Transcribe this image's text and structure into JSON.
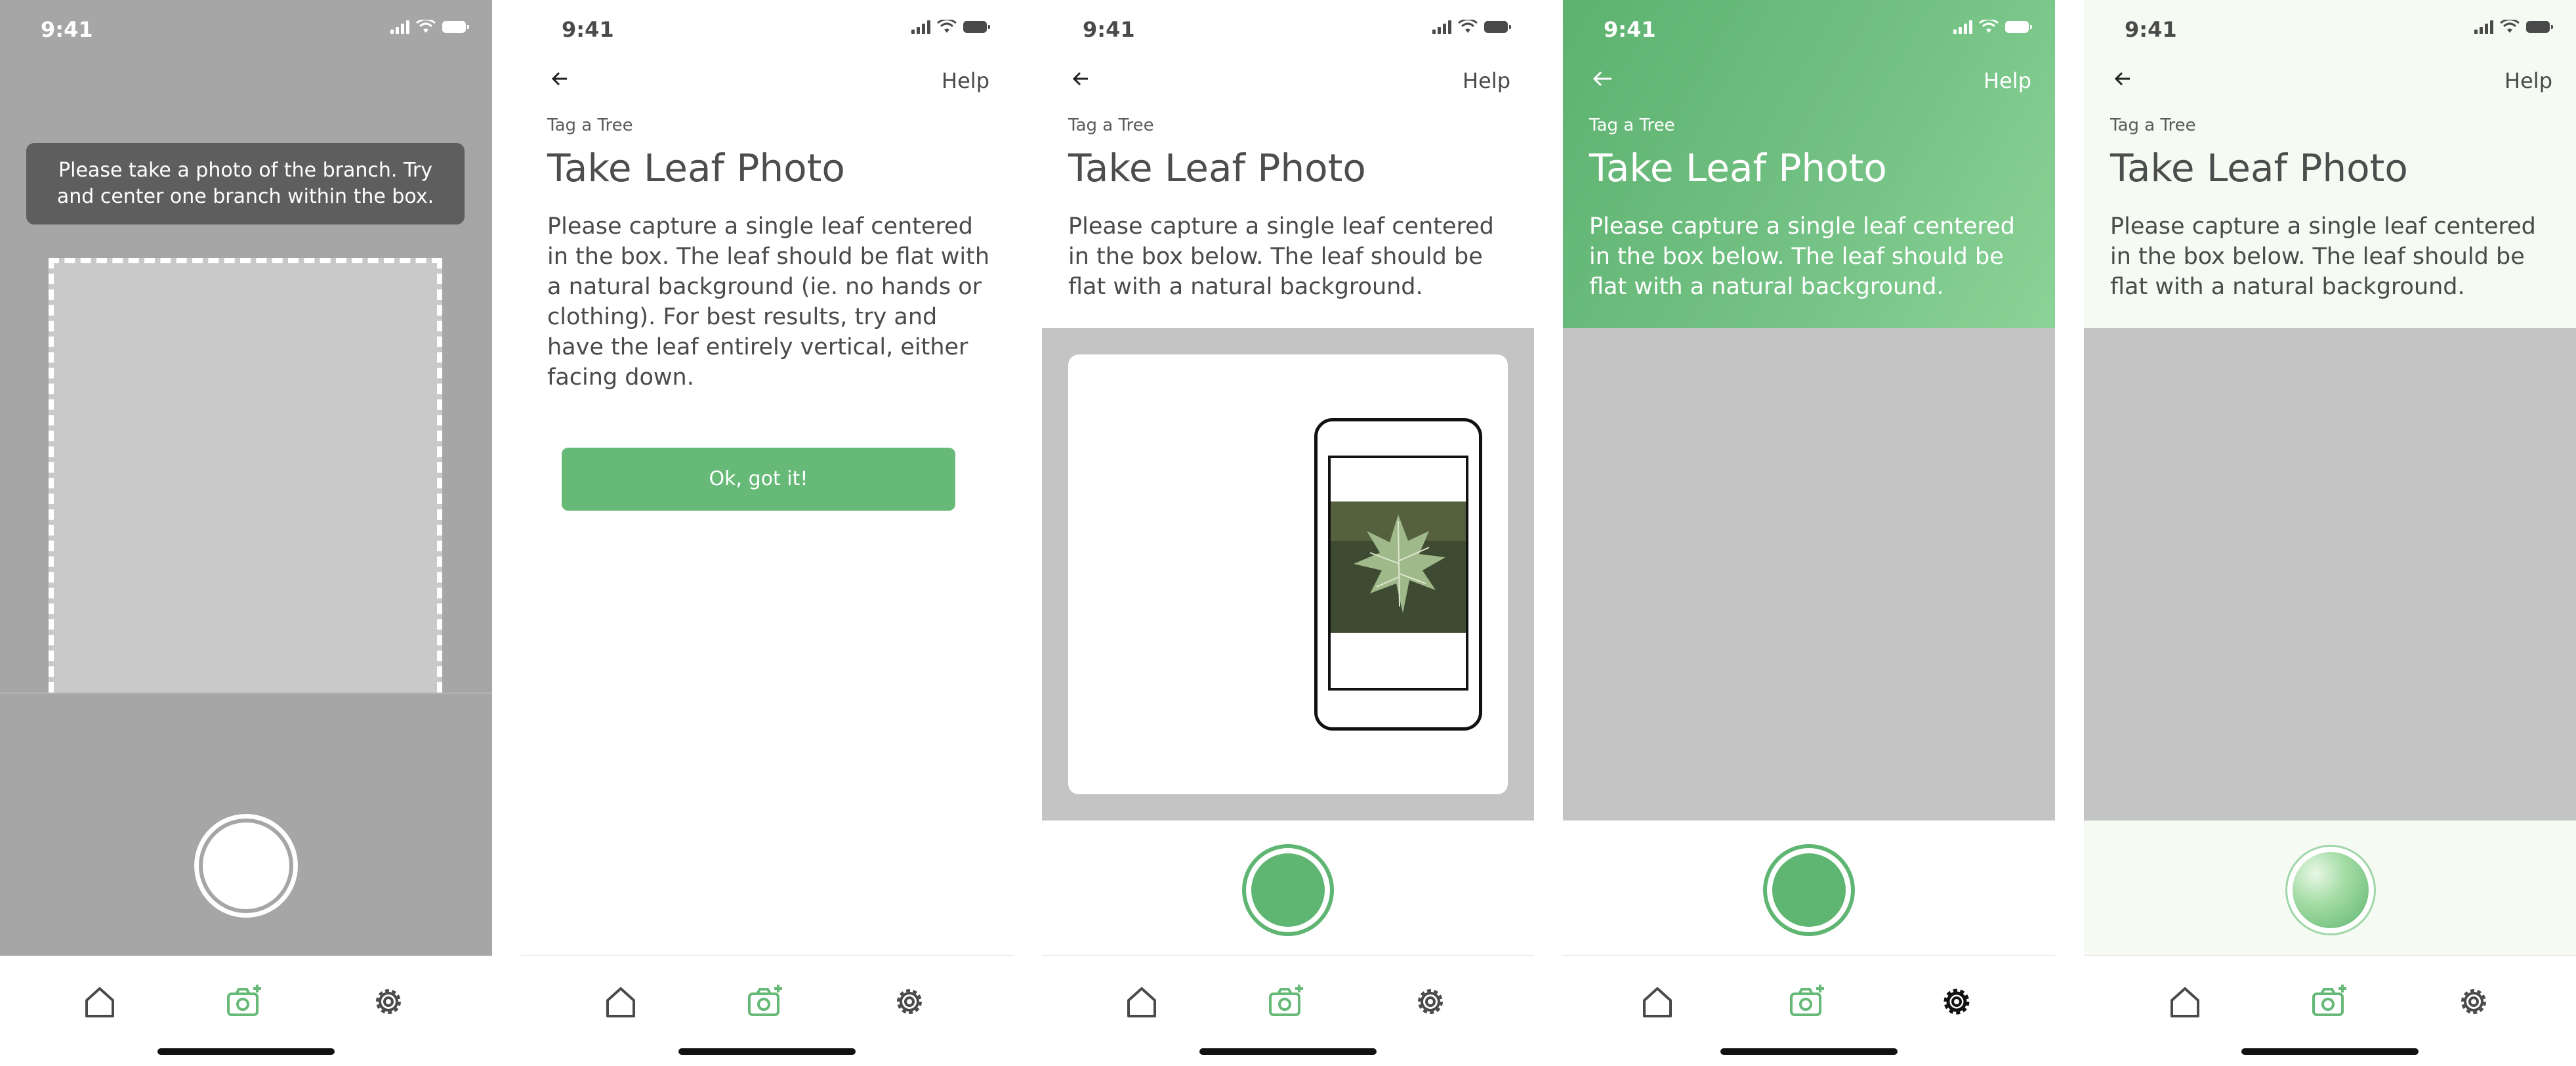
{
  "status_time": "9:41",
  "nav": {
    "help_label": "Help",
    "back_icon": "arrow-left-icon"
  },
  "screen_common": {
    "kicker": "Tag a Tree",
    "title": "Take Leaf Photo"
  },
  "screen1": {
    "tooltip": "Please take a photo of the branch. Try and center one branch within the box."
  },
  "screen2": {
    "description": "Please capture a single leaf centered in the box. The leaf should be flat with a natural background (ie. no hands or clothing). For best results, try and have the leaf entirely vertical, either facing down.",
    "button_label": "Ok, got it!"
  },
  "screen3": {
    "description": "Please capture a single leaf centered in the box below. The leaf should be flat with a natural background."
  },
  "screen4": {
    "description": "Please capture a single leaf centered in the box below. The leaf should be flat with a natural background."
  },
  "screen5": {
    "description": "Please capture a single leaf centered in the box below. The leaf should be flat with a natural background."
  },
  "tabs": [
    "home-icon",
    "camera-plus-icon",
    "settings-gear-icon"
  ],
  "colors": {
    "accent": "#66b977",
    "dark_text": "#4a4a4a",
    "gray_overlay": "#a6a6a6",
    "photo_area": "#c4c4c4"
  }
}
